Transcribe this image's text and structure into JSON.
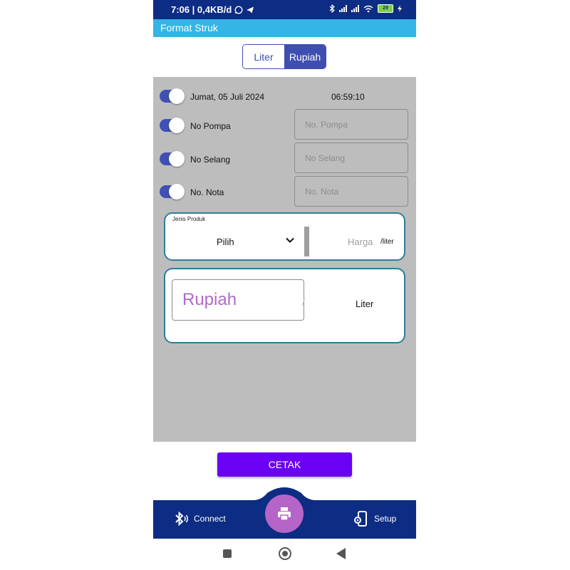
{
  "status_bar": {
    "time_info": "7:06 | 0,4KB/d",
    "battery": "29"
  },
  "app_bar": {
    "title": "Format Struk"
  },
  "mode_toggle": {
    "liter_label": "Liter",
    "rupiah_label": "Rupiah",
    "selected": "Rupiah"
  },
  "rows": {
    "date": {
      "label": "Jumat, 05 Juli 2024",
      "time": "06:59:10",
      "enabled": true
    },
    "no_pompa": {
      "label": "No Pompa",
      "placeholder": "No. Pompa",
      "enabled": true
    },
    "no_selang": {
      "label": "No Selang",
      "placeholder": "No Selang",
      "enabled": true
    },
    "no_nota": {
      "label": "No. Nota",
      "placeholder": "No. Nota",
      "enabled": true
    }
  },
  "product": {
    "label": "Jenis Produk",
    "selected": "Pilih",
    "harga_placeholder": "Harga",
    "unit": "/liter"
  },
  "amount": {
    "rupiah_placeholder": "Rupiah",
    "liter_label": "Liter"
  },
  "cetak_label": "CETAK",
  "bottom_nav": {
    "connect_label": "Connect",
    "setup_label": "Setup"
  },
  "colors": {
    "status_bar": "#0d2c83",
    "app_bar": "#33b5e5",
    "accent": "#3f4fb0",
    "cetak": "#6a00f4",
    "fab": "#b564c8"
  }
}
